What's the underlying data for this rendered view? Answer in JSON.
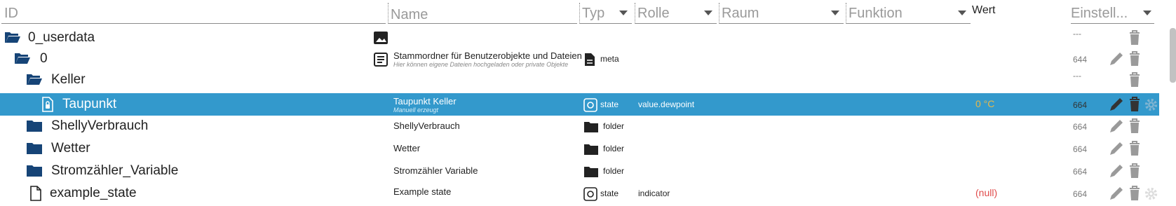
{
  "columns": {
    "id": "ID",
    "name": "Name",
    "typ": "Typ",
    "rolle": "Rolle",
    "raum": "Raum",
    "funktion": "Funktion",
    "wert": "Wert",
    "einstellungen": "Einstell..."
  },
  "rows": [
    {
      "label": "0_userdata",
      "name": "",
      "name_sub": "",
      "type": "",
      "role": "",
      "value": "",
      "rights": "---",
      "icon": "folder-open-icon",
      "side_icon": "image-icon"
    },
    {
      "label": "0",
      "name": "Stammordner für Benutzerobjekte und Dateien",
      "name_sub": "Hier können eigene Dateien hochgeladen oder private Objekte",
      "type": "meta",
      "role": "",
      "value": "",
      "rights": "644",
      "icon": "folder-open-icon",
      "side_icon": "document-icon"
    },
    {
      "label": "Keller",
      "name": "",
      "name_sub": "",
      "type": "",
      "role": "",
      "value": "",
      "rights": "---",
      "icon": "folder-open-icon",
      "side_icon": ""
    },
    {
      "label": "Taupunkt",
      "name": "Taupunkt Keller",
      "name_sub": "Manuell erzeugt",
      "type": "state",
      "role": "value.dewpoint",
      "value": "0 °C",
      "rights": "664",
      "icon": "state-file-icon",
      "side_icon": "",
      "selected": true
    },
    {
      "label": "ShellyVerbrauch",
      "name": "ShellyVerbrauch",
      "name_sub": "",
      "type": "folder",
      "role": "",
      "value": "",
      "rights": "664",
      "icon": "folder-icon",
      "side_icon": ""
    },
    {
      "label": "Wetter",
      "name": "Wetter",
      "name_sub": "",
      "type": "folder",
      "role": "",
      "value": "",
      "rights": "664",
      "icon": "folder-icon",
      "side_icon": ""
    },
    {
      "label": "Stromzähler_Variable",
      "name": "Stromzähler Variable",
      "name_sub": "",
      "type": "folder",
      "role": "",
      "value": "",
      "rights": "664",
      "icon": "folder-icon",
      "side_icon": ""
    },
    {
      "label": "example_state",
      "name": "Example state",
      "name_sub": "",
      "type": "state",
      "role": "indicator",
      "value": "(null)",
      "rights": "664",
      "icon": "file-icon",
      "side_icon": ""
    }
  ],
  "colors": {
    "selected_row": "#3399cc",
    "folder_icon": "#164477",
    "value_warm": "#e6b84a",
    "value_null": "#e04a4a"
  }
}
